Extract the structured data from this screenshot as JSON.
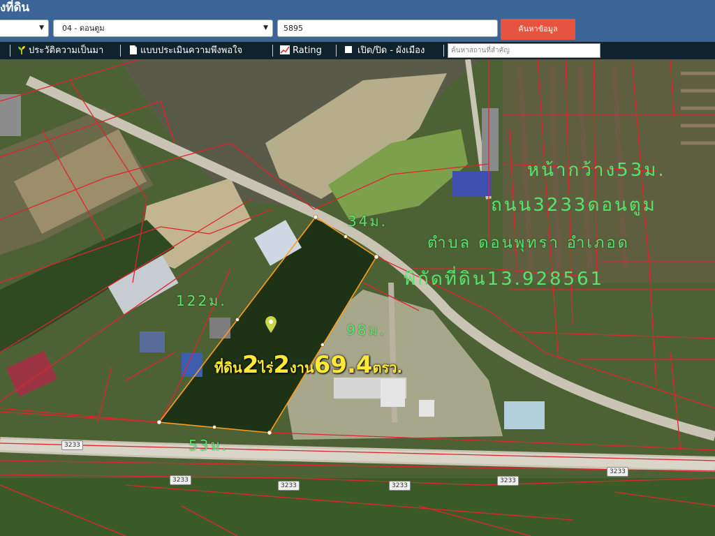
{
  "header": {
    "title": "งที่ดิน",
    "province_label": "",
    "district_label": "04 - ดอนตูม",
    "parcel_value": "5895",
    "search_button": "ค้นหาข้อมูล"
  },
  "toolbar": {
    "items": [
      "ประวัติความเป็นมา",
      "แบบประเมินความพึงพอใจ",
      "Rating",
      "เปิด/ปิด - ผังเมือง"
    ],
    "place_search_placeholder": "ค้นหาสถานที่สำคัญ"
  },
  "map": {
    "info_lines": [
      "หน้ากว้าง53ม.",
      "ถนน3233ดอนตูม",
      "ตำบล ดอนพุทรา อำเภอด",
      "พิกัดที่ดิน13.928561"
    ],
    "dimensions": {
      "top": "34ม.",
      "left": "122ม.",
      "right": "98ม.",
      "bottom": "53ม."
    },
    "area": {
      "prefix": "ที่ดิน",
      "rai": "2",
      "rai_unit": "ไร่",
      "ngan": "2",
      "ngan_unit": "งาน",
      "wa": "69.4",
      "wa_unit": "ตรว."
    },
    "road_badges": [
      "3233",
      "3233",
      "3233",
      "3233",
      "3233",
      "3233"
    ],
    "colors": {
      "parcel_lines": "#e0242d",
      "plot_outline": "#ff9d1c",
      "label_green": "#56e56c",
      "label_yellow": "#ffe934"
    }
  }
}
